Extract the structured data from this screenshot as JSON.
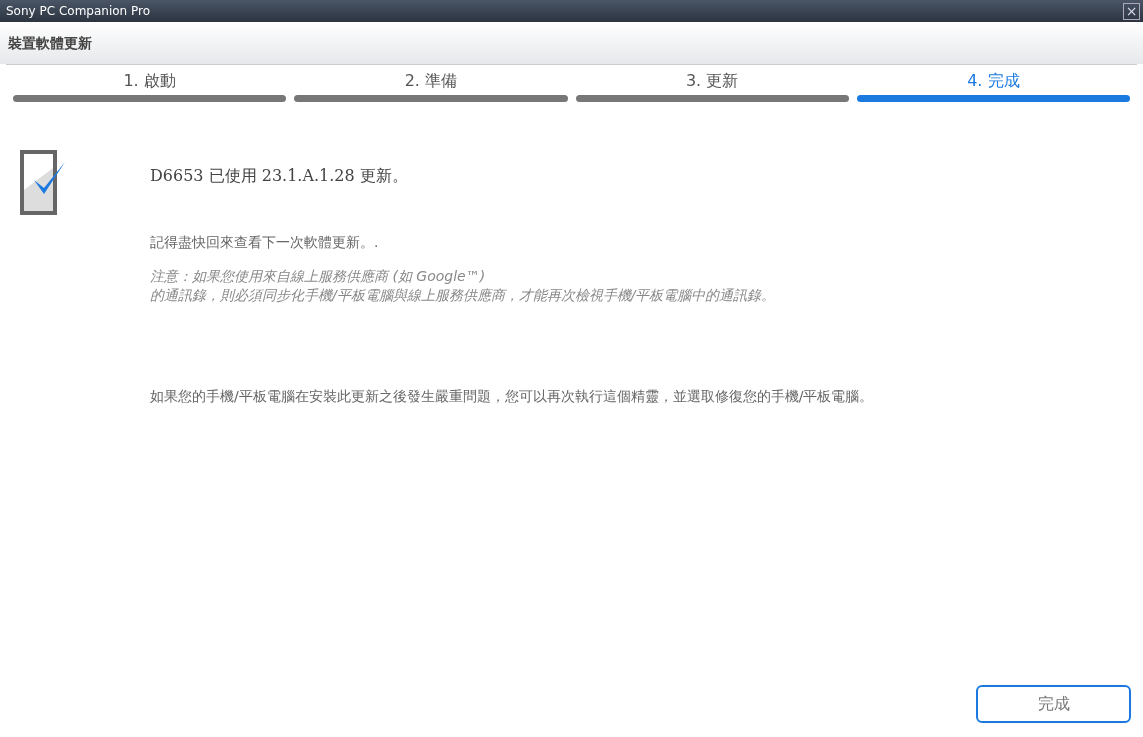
{
  "window": {
    "title": "Sony PC Companion Pro",
    "close": "×"
  },
  "header": {
    "title": "裝置軟體更新"
  },
  "steps": [
    {
      "label": "1. 啟動",
      "selected": false
    },
    {
      "label": "2. 準備",
      "selected": false
    },
    {
      "label": "3. 更新",
      "selected": false
    },
    {
      "label": "4. 完成",
      "selected": true
    }
  ],
  "content": {
    "heading": "D6653 已使用 23.1.A.1.28 更新。",
    "reminder": "記得盡快回來查看下一次軟體更新。.",
    "note": "注意：如果您使用來自線上服務供應商 (如 Google™)\n的通訊錄，則必須同步化手機/平板電腦與線上服務供應商，才能再次檢視手機/平板電腦中的通訊錄。",
    "repair": "如果您的手機/平板電腦在安裝此更新之後發生嚴重問題，您可以再次執行這個精靈，並選取修復您的手機/平板電腦。"
  },
  "buttons": [
    "完成"
  ]
}
